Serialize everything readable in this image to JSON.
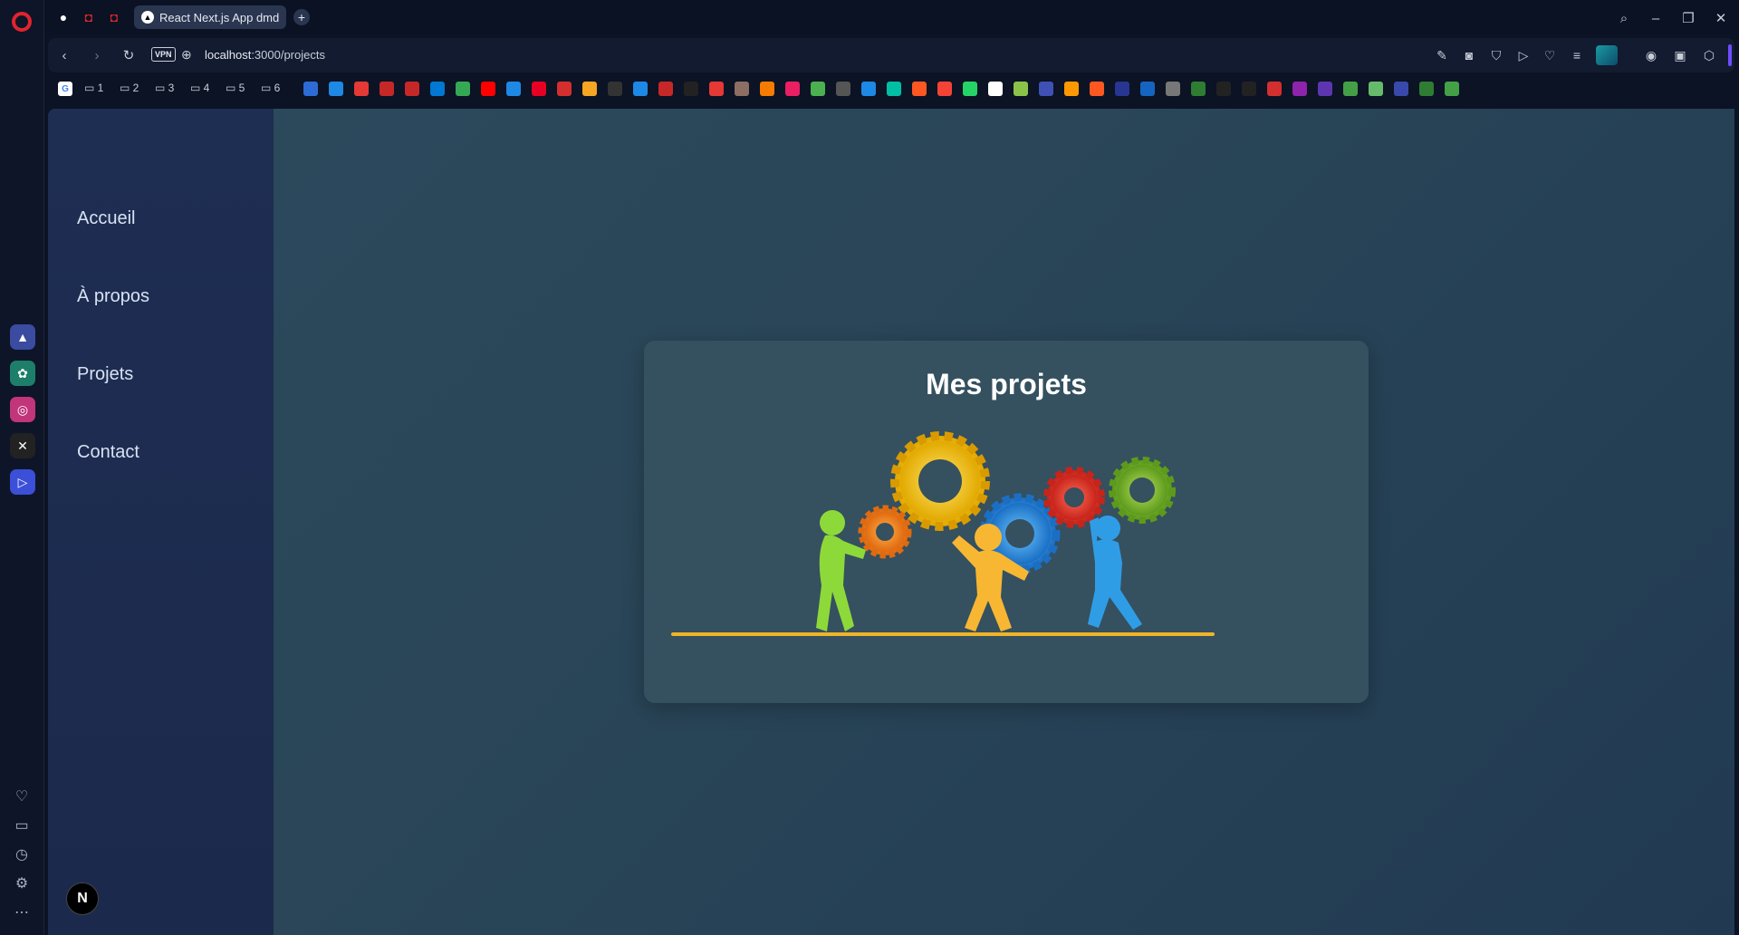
{
  "browser": {
    "tab": {
      "title": "React Next.js App dmd"
    },
    "address": {
      "host": "localhost",
      "path": ":3000/projects",
      "vpn_label": "VPN"
    },
    "bookmark_folders": [
      {
        "label": "1"
      },
      {
        "label": "2"
      },
      {
        "label": "3"
      },
      {
        "label": "4"
      },
      {
        "label": "5"
      },
      {
        "label": "6"
      }
    ]
  },
  "site": {
    "nav": {
      "items": [
        {
          "label": "Accueil"
        },
        {
          "label": "À propos"
        },
        {
          "label": "Projets"
        },
        {
          "label": "Contact"
        }
      ]
    },
    "card": {
      "title": "Mes projets"
    },
    "next_badge": "N"
  },
  "colors": {
    "page_bg": "#2c4a5e",
    "sidebar_bg": "#1e2d52",
    "card_bg": "#35505f",
    "ground_line": "#f0b429"
  }
}
